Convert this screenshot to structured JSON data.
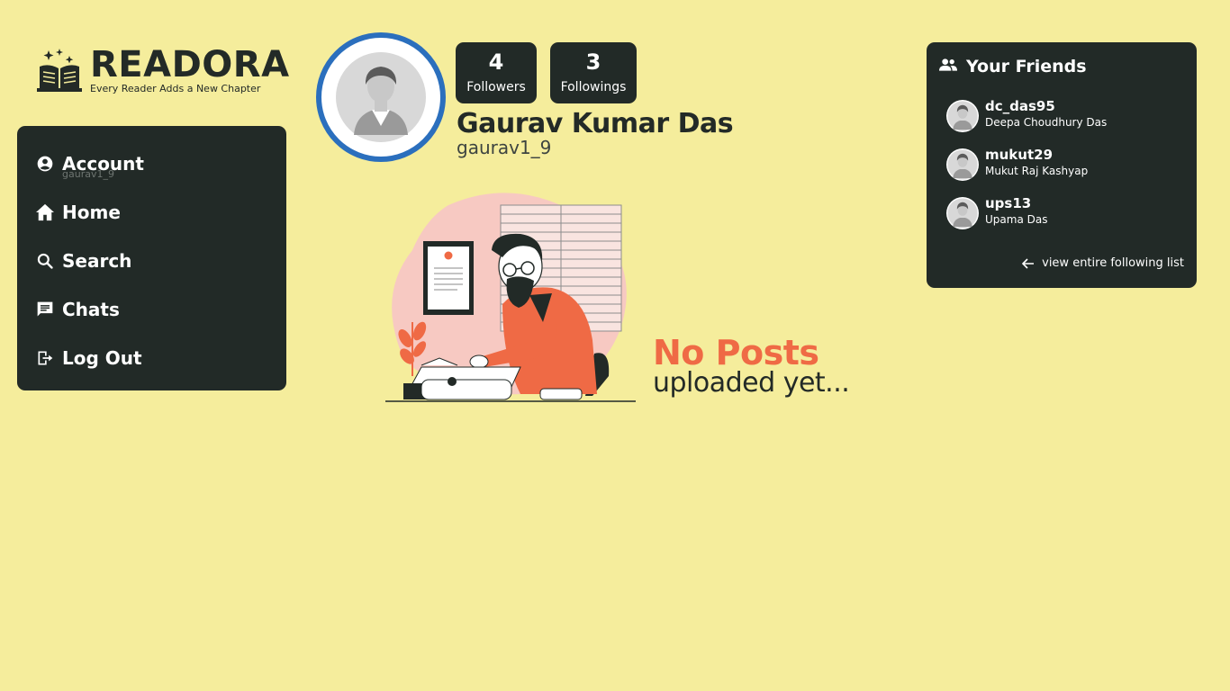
{
  "brand": {
    "name": "READORA",
    "tagline": "Every Reader Adds a New Chapter"
  },
  "sidebar": {
    "items": [
      {
        "label": "Account",
        "sub": "gaurav1_9",
        "icon": "account-circle-icon"
      },
      {
        "label": "Home",
        "icon": "home-icon"
      },
      {
        "label": "Search",
        "icon": "search-icon"
      },
      {
        "label": "Chats",
        "icon": "chat-icon"
      },
      {
        "label": "Log Out",
        "icon": "logout-icon"
      }
    ]
  },
  "profile": {
    "name": "Gaurav Kumar Das",
    "handle": "gaurav1_9",
    "followers": {
      "count": "4",
      "label": "Followers"
    },
    "followings": {
      "count": "3",
      "label": "Followings"
    }
  },
  "posts": {
    "empty_title": "No Posts",
    "empty_sub": "uploaded yet..."
  },
  "friends": {
    "title": "Your Friends",
    "items": [
      {
        "username": "dc_das95",
        "fullname": "Deepa Choudhury Das"
      },
      {
        "username": "mukut29",
        "fullname": "Mukut Raj Kashyap"
      },
      {
        "username": "ups13",
        "fullname": "Upama Das"
      }
    ],
    "view_all": "view entire following list"
  },
  "colors": {
    "background": "#f5ed9c",
    "panel": "#222a27",
    "accent": "#ef6a45",
    "avatar_ring": "#2b6fbd"
  }
}
